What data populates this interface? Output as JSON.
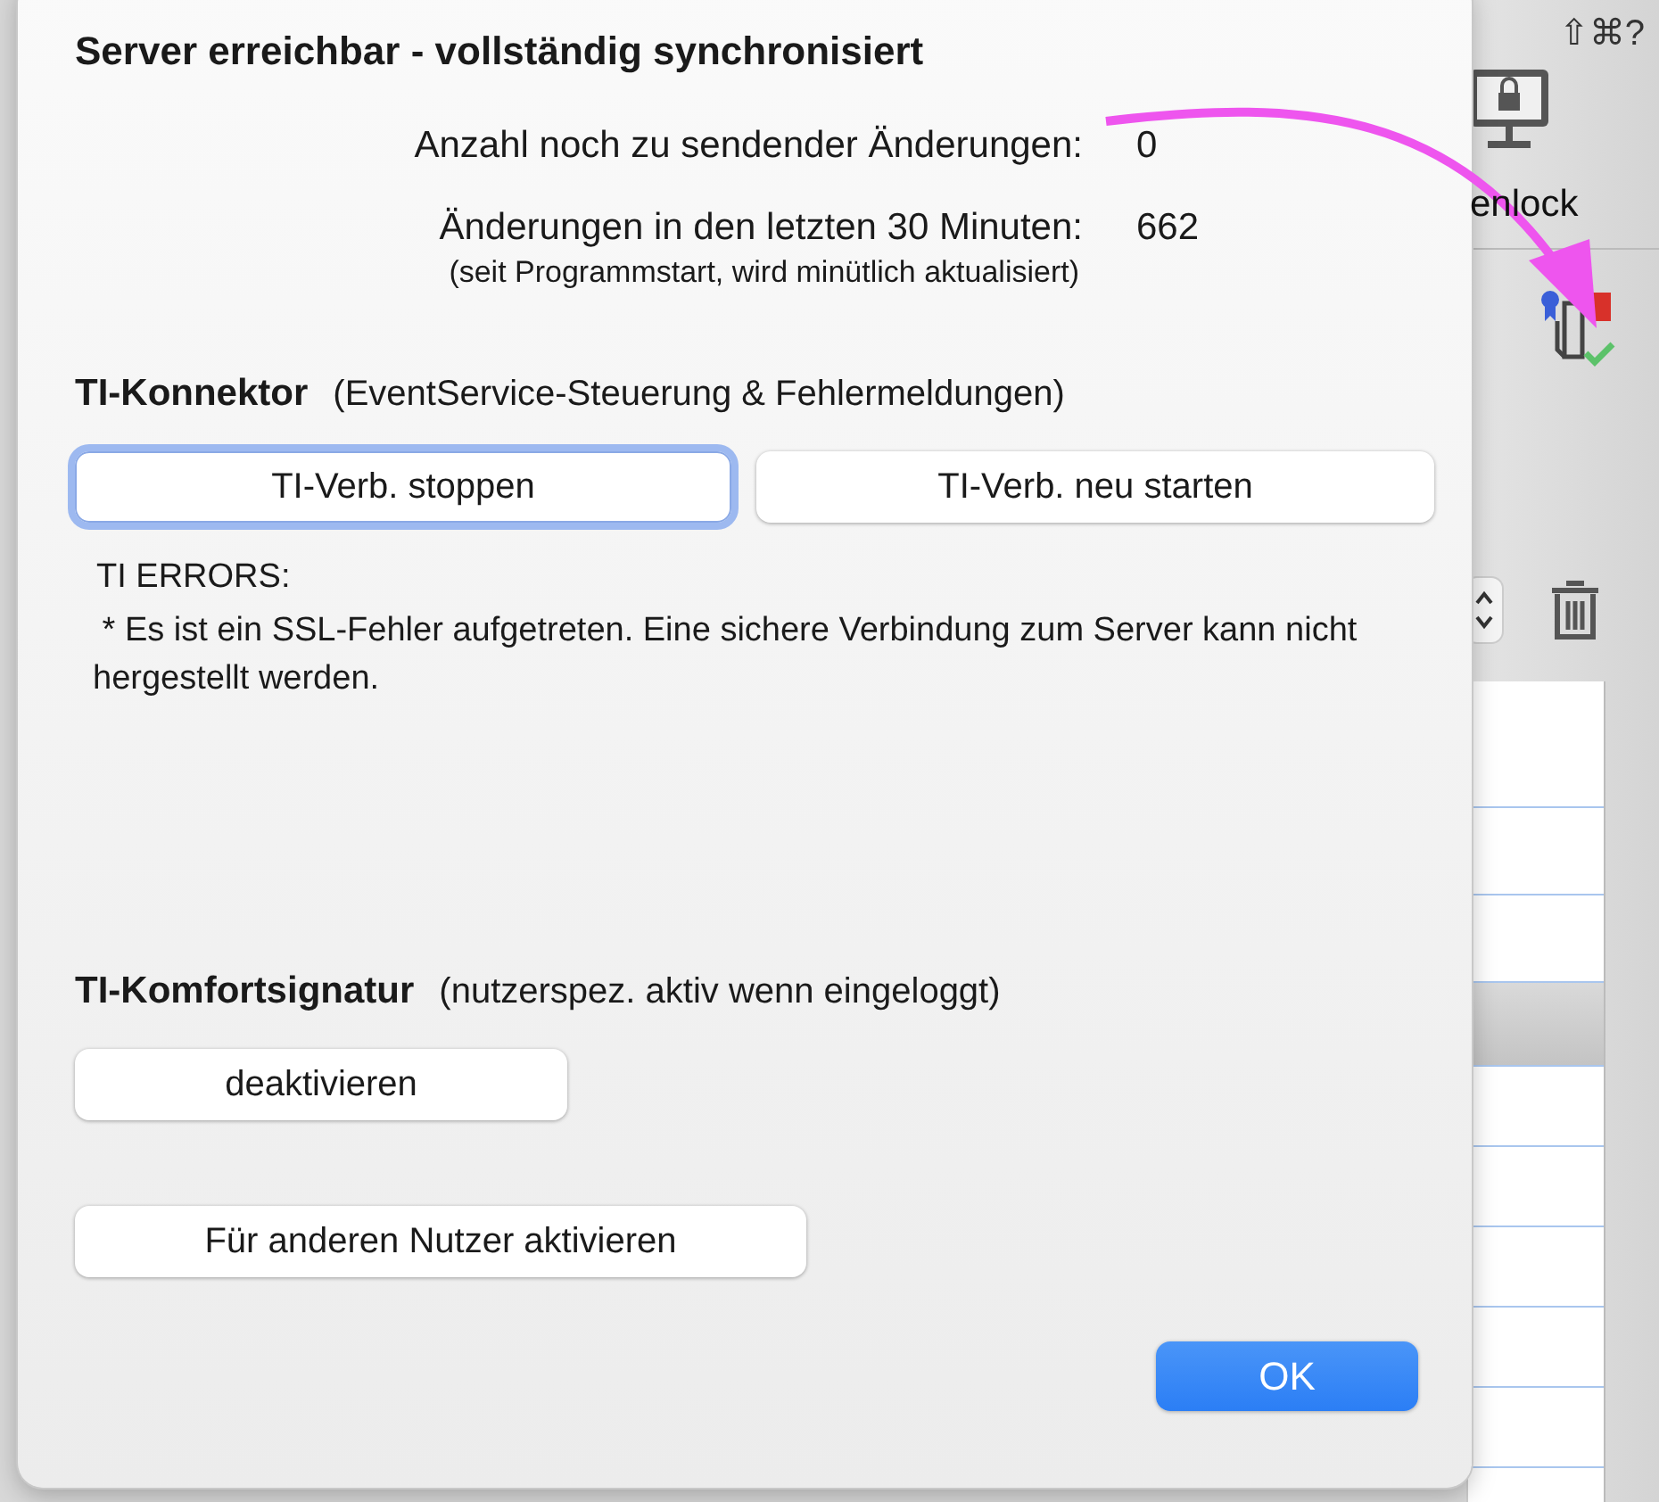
{
  "app": {
    "shortcut_hint": "⇧⌘?",
    "lock_label": "enlock"
  },
  "popover": {
    "title": "Server erreichbar - vollständig synchronisiert",
    "stats": [
      {
        "label": "Anzahl noch zu sendender Änderungen:",
        "value": "0"
      },
      {
        "label": "Änderungen in den letzten 30 Minuten:",
        "value": "662"
      }
    ],
    "stats_note": "(seit Programmstart, wird minütlich aktualisiert)",
    "connector": {
      "title": "TI-Konnektor",
      "subtitle": "(EventService-Steuerung & Fehlermeldungen)",
      "buttons": [
        {
          "label": "TI-Verb. stoppen",
          "focused": true
        },
        {
          "label": "TI-Verb. neu starten",
          "focused": false
        }
      ],
      "errors_heading": "TI ERRORS:",
      "errors_message": " * Es ist ein SSL-Fehler aufgetreten. Eine sichere Verbindung zum Server kann nicht hergestellt werden."
    },
    "signature": {
      "title": "TI-Komfortsignatur",
      "subtitle": "(nutzerspez. aktiv wenn eingeloggt)",
      "buttons": [
        {
          "label": "deaktivieren",
          "focused": false
        },
        {
          "label": "Für anderen Nutzer aktivieren",
          "focused": false
        }
      ]
    },
    "ok_button": {
      "label": "OK",
      "default": true
    }
  }
}
